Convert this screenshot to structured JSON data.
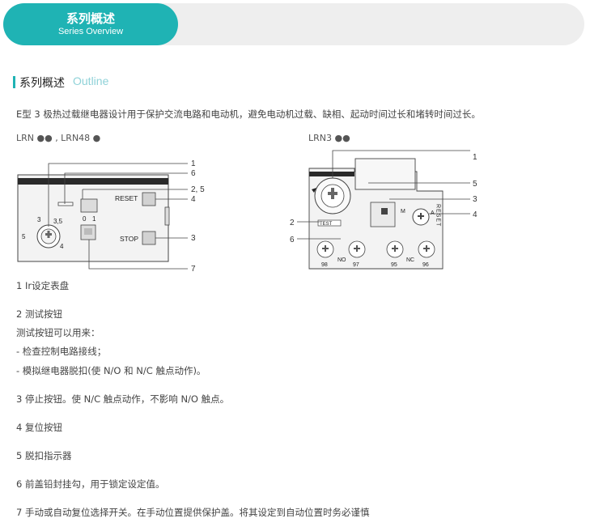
{
  "banner": {
    "title_cn": "系列概述",
    "title_en": "Series Overview"
  },
  "section": {
    "title_cn": "系列概述",
    "title_en": "Outline"
  },
  "intro": "E型 3 极热过载继电器设计用于保护交流电路和电动机，避免电动机过载、缺相、起动时间过长和堵转时间过长。",
  "models": {
    "left": "LRN ●● , LRN48 ●",
    "right": "LRN3 ●●"
  },
  "diagram_left": {
    "callouts": [
      "1",
      "6",
      "2, 5",
      "4",
      "3",
      "7"
    ],
    "buttons": [
      "RESET",
      "STOP"
    ],
    "dial_marks": [
      "3",
      "3,5",
      "5",
      "4"
    ],
    "selector": [
      "0",
      "1"
    ]
  },
  "diagram_right": {
    "callouts_right": [
      "1",
      "5",
      "3",
      "4"
    ],
    "callouts_left": [
      "2",
      "6"
    ],
    "labels": [
      "RESET",
      "TEST",
      "M",
      "A"
    ],
    "terminals": [
      "98",
      "NO",
      "97",
      "95",
      "NC",
      "96"
    ]
  },
  "items": [
    "1 Ir设定表盘",
    "2 测试按钮",
    "测试按钮可以用来：",
    "- 检查控制电路接线；",
    "- 模拟继电器脱扣(使 N/O 和 N/C 触点动作)。",
    "3 停止按钮。使 N/C 触点动作，不影响 N/O 触点。",
    "4 复位按钮",
    "5 脱扣指示器",
    "6 前盖铅封挂勾，用于锁定设定值。",
    "7 手动或自动复位选择开关。在手动位置提供保护盖。将其设定到自动位置时务必谨慎"
  ]
}
